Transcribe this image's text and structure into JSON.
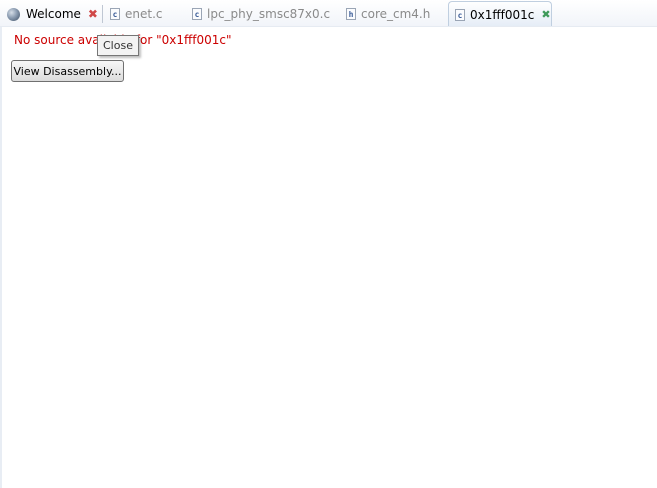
{
  "tabs": [
    {
      "label": "Welcome",
      "icon": "globe-icon",
      "close_icon": "close-icon",
      "close_color": "#d04848"
    },
    {
      "label": "enet.c",
      "icon": "c-file-icon",
      "badge": "c"
    },
    {
      "label": "lpc_phy_smsc87x0.c",
      "icon": "c-file-icon",
      "badge": "c"
    },
    {
      "label": "core_cm4.h",
      "icon": "h-file-icon",
      "badge": "h"
    },
    {
      "label": "0x1fff001c",
      "icon": "c-file-icon",
      "badge": "c",
      "active": true,
      "close_icon": "close-icon",
      "close_color": "#3f9a5a"
    }
  ],
  "editor": {
    "message": "No source available for \"0x1fff001c\"",
    "message_color": "#cc0000",
    "view_disassembly_label": "View Disassembly..."
  },
  "tooltip": {
    "text": "Close"
  }
}
